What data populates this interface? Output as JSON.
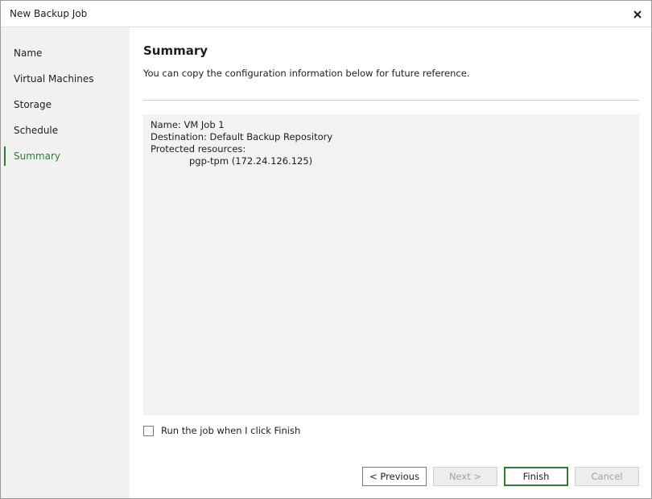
{
  "window": {
    "title": "New Backup Job",
    "close_icon": "close-icon"
  },
  "sidebar": {
    "items": [
      {
        "label": "Name",
        "active": false
      },
      {
        "label": "Virtual Machines",
        "active": false
      },
      {
        "label": "Storage",
        "active": false
      },
      {
        "label": "Schedule",
        "active": false
      },
      {
        "label": "Summary",
        "active": true
      }
    ]
  },
  "main": {
    "title": "Summary",
    "subtitle": "You can copy the configuration information below for future reference.",
    "summary": {
      "name_line": "Name: VM Job 1",
      "destination_line": "Destination: Default Backup Repository",
      "resources_header": "Protected resources:",
      "resource": "pgp-tpm (172.24.126.125)"
    },
    "run_checkbox": {
      "label": "Run the job when I click Finish",
      "checked": false
    }
  },
  "buttons": {
    "previous": "< Previous",
    "next": "Next >",
    "finish": "Finish",
    "cancel": "Cancel"
  },
  "colors": {
    "accent": "#2e7d32",
    "sidebar_bg": "#f0f1f0",
    "summary_bg": "#f1f2f1",
    "disabled_text": "#a0a0a0"
  }
}
